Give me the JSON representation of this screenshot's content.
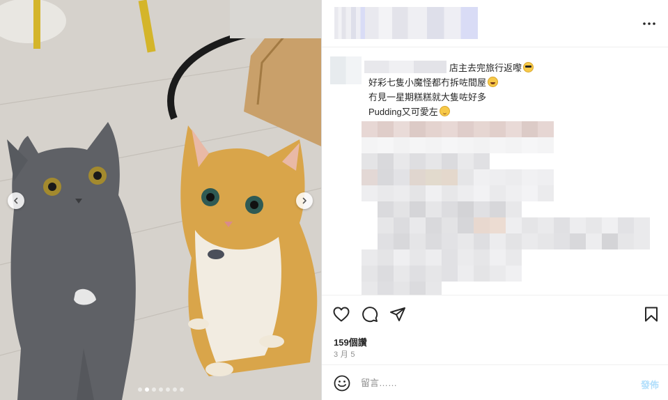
{
  "post": {
    "caption": {
      "line1": "店主去完旅行返嚟",
      "line2": "好彩七隻小魔怪都冇拆咗間屋",
      "line3": "冇見一星期糕糕就大隻咗好多",
      "line4": "Pudding又可愛左"
    },
    "likes": "159個讚",
    "date": "3 月 5"
  },
  "carousel": {
    "total_slides": 7,
    "active_slide": 2
  },
  "comment": {
    "placeholder": "留言……",
    "post_label": "發佈"
  },
  "colors": {
    "post_button_disabled": "#b2dffc",
    "border": "#dbdbdb",
    "muted_text": "#8e8e8e"
  }
}
